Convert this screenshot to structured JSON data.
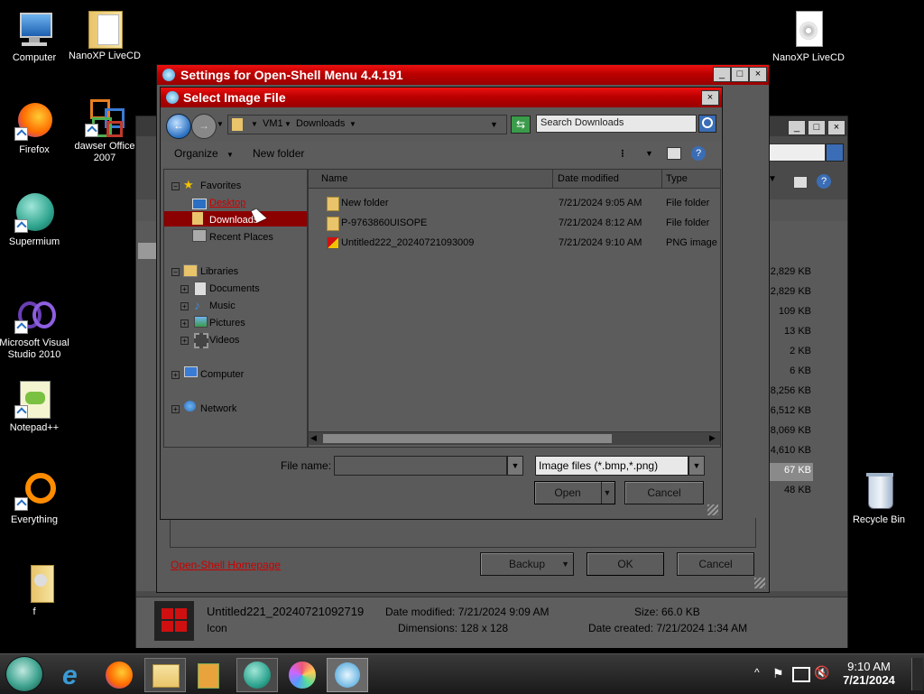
{
  "desktop": {
    "icons": [
      {
        "label": "Computer"
      },
      {
        "label": "NanoXP LiveCD"
      },
      {
        "label": "NanoXP LiveCD"
      },
      {
        "label": "Firefox"
      },
      {
        "label": "dawser Office 2007"
      },
      {
        "label": "Supermium"
      },
      {
        "label": "Microsoft Visual Studio 2010"
      },
      {
        "label": "Notepad++"
      },
      {
        "label": "Everything"
      },
      {
        "label": "f"
      },
      {
        "label": "Recycle Bin"
      }
    ]
  },
  "settings_window": {
    "title": "Settings for Open-Shell Menu 4.4.191",
    "link": "Open-Shell Homepage",
    "buttons": {
      "backup": "Backup",
      "ok": "OK",
      "cancel": "Cancel"
    }
  },
  "back_explorer": {
    "sizes": [
      "2,829 KB",
      "2,829 KB",
      "109 KB",
      "13 KB",
      "2 KB",
      "6 KB",
      "8,256 KB",
      "6,512 KB",
      "8,069 KB",
      "4,610 KB",
      "67 KB",
      "48 KB"
    ],
    "details": {
      "filename": "Untitled221_20240721092719",
      "type": "Icon",
      "date_modified": "Date modified: 7/21/2024 9:09 AM",
      "dimensions": "Dimensions: 128 x 128",
      "size": "Size: 66.0 KB",
      "date_created": "Date created: 7/21/2024 1:34 AM"
    }
  },
  "dialog": {
    "title": "Select Image File",
    "breadcrumb": [
      "VM1",
      "Downloads"
    ],
    "search_placeholder": "Search Downloads",
    "toolbar": {
      "organize": "Organize",
      "new_folder": "New folder"
    },
    "nav": {
      "favorites": "Favorites",
      "desktop": "Desktop",
      "downloads": "Downloads",
      "recent": "Recent Places",
      "libraries": "Libraries",
      "documents": "Documents",
      "music": "Music",
      "pictures": "Pictures",
      "videos": "Videos",
      "computer": "Computer",
      "network": "Network"
    },
    "columns": {
      "name": "Name",
      "date": "Date modified",
      "type": "Type"
    },
    "files": [
      {
        "name": "New folder",
        "date": "7/21/2024 9:05 AM",
        "type": "File folder"
      },
      {
        "name": "P-9763860UISOPE",
        "date": "7/21/2024 8:12 AM",
        "type": "File folder"
      },
      {
        "name": "Untitled222_20240721093009",
        "date": "7/21/2024 9:10 AM",
        "type": "PNG image"
      }
    ],
    "filename_label": "File name:",
    "filename_value": "",
    "filetype": "Image files (*.bmp,*.png)",
    "open": "Open",
    "cancel": "Cancel"
  },
  "taskbar": {
    "time": "9:10 AM",
    "date": "7/21/2024",
    "tray_arrow": "^"
  },
  "colors": {
    "accent_red": "#cc0000",
    "selection": "#8b0000",
    "link": "#cc0000"
  }
}
